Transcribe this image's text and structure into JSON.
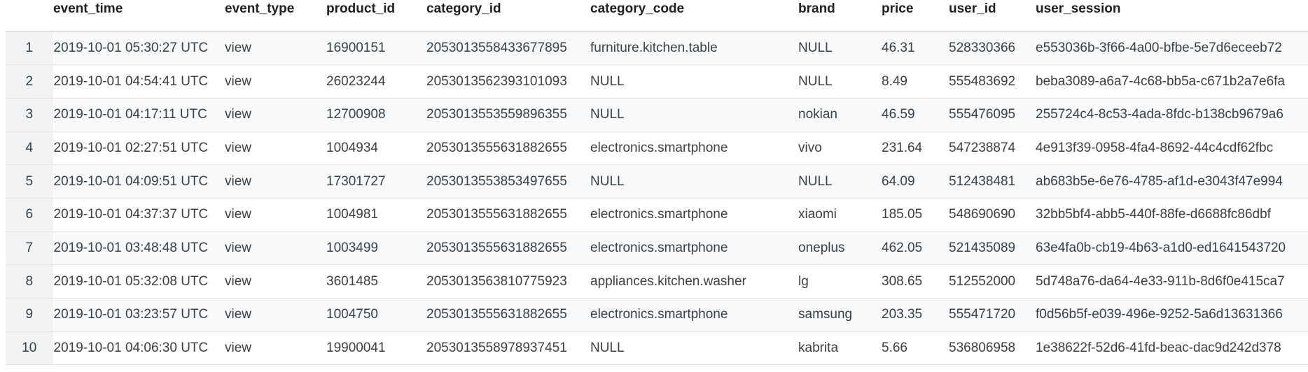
{
  "columns": [
    "event_time",
    "event_type",
    "product_id",
    "category_id",
    "category_code",
    "brand",
    "price",
    "user_id",
    "user_session"
  ],
  "rows": [
    {
      "num": "1",
      "event_time": "2019-10-01 05:30:27 UTC",
      "event_type": "view",
      "product_id": "16900151",
      "category_id": "2053013558433677895",
      "category_code": "furniture.kitchen.table",
      "brand": "NULL",
      "price": "46.31",
      "user_id": "528330366",
      "user_session": "e553036b-3f66-4a00-bfbe-5e7d6eceeb72"
    },
    {
      "num": "2",
      "event_time": "2019-10-01 04:54:41 UTC",
      "event_type": "view",
      "product_id": "26023244",
      "category_id": "2053013562393101093",
      "category_code": "NULL",
      "brand": "NULL",
      "price": "8.49",
      "user_id": "555483692",
      "user_session": "beba3089-a6a7-4c68-bb5a-c671b2a7e6fa"
    },
    {
      "num": "3",
      "event_time": "2019-10-01 04:17:11 UTC",
      "event_type": "view",
      "product_id": "12700908",
      "category_id": "2053013553559896355",
      "category_code": "NULL",
      "brand": "nokian",
      "price": "46.59",
      "user_id": "555476095",
      "user_session": "255724c4-8c53-4ada-8fdc-b138cb9679a6"
    },
    {
      "num": "4",
      "event_time": "2019-10-01 02:27:51 UTC",
      "event_type": "view",
      "product_id": "1004934",
      "category_id": "2053013555631882655",
      "category_code": "electronics.smartphone",
      "brand": "vivo",
      "price": "231.64",
      "user_id": "547238874",
      "user_session": "4e913f39-0958-4fa4-8692-44c4cdf62fbc"
    },
    {
      "num": "5",
      "event_time": "2019-10-01 04:09:51 UTC",
      "event_type": "view",
      "product_id": "17301727",
      "category_id": "2053013553853497655",
      "category_code": "NULL",
      "brand": "NULL",
      "price": "64.09",
      "user_id": "512438481",
      "user_session": "ab683b5e-6e76-4785-af1d-e3043f47e994"
    },
    {
      "num": "6",
      "event_time": "2019-10-01 04:37:37 UTC",
      "event_type": "view",
      "product_id": "1004981",
      "category_id": "2053013555631882655",
      "category_code": "electronics.smartphone",
      "brand": "xiaomi",
      "price": "185.05",
      "user_id": "548690690",
      "user_session": "32bb5bf4-abb5-440f-88fe-d6688fc86dbf"
    },
    {
      "num": "7",
      "event_time": "2019-10-01 03:48:48 UTC",
      "event_type": "view",
      "product_id": "1003499",
      "category_id": "2053013555631882655",
      "category_code": "electronics.smartphone",
      "brand": "oneplus",
      "price": "462.05",
      "user_id": "521435089",
      "user_session": "63e4fa0b-cb19-4b63-a1d0-ed1641543720"
    },
    {
      "num": "8",
      "event_time": "2019-10-01 05:32:08 UTC",
      "event_type": "view",
      "product_id": "3601485",
      "category_id": "2053013563810775923",
      "category_code": "appliances.kitchen.washer",
      "brand": "lg",
      "price": "308.65",
      "user_id": "512552000",
      "user_session": "5d748a76-da64-4e33-911b-8d6f0e415ca7"
    },
    {
      "num": "9",
      "event_time": "2019-10-01 03:23:57 UTC",
      "event_type": "view",
      "product_id": "1004750",
      "category_id": "2053013555631882655",
      "category_code": "electronics.smartphone",
      "brand": "samsung",
      "price": "203.35",
      "user_id": "555471720",
      "user_session": "f0d56b5f-e039-496e-9252-5a6d13631366"
    },
    {
      "num": "10",
      "event_time": "2019-10-01 04:06:30 UTC",
      "event_type": "view",
      "product_id": "19900041",
      "category_id": "2053013558978937451",
      "category_code": "NULL",
      "brand": "kabrita",
      "price": "5.66",
      "user_id": "536806958",
      "user_session": "1e38622f-52d6-41fd-beac-dac9d242d378"
    }
  ]
}
